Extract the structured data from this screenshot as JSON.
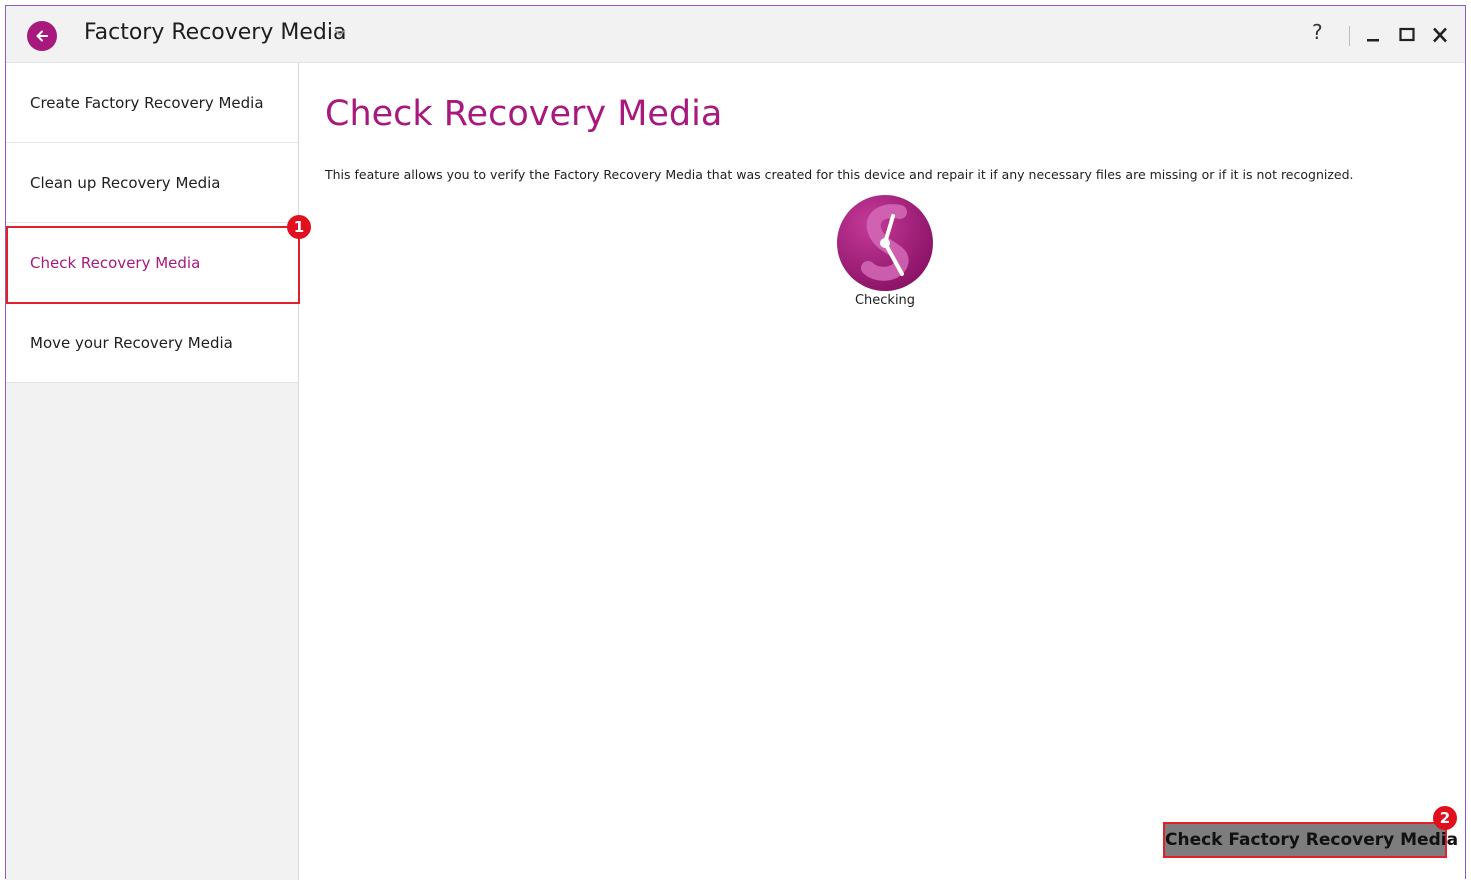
{
  "app": {
    "title": "Factory Recovery Media",
    "help_label": "?"
  },
  "sidebar": {
    "items": [
      {
        "label": "Create Factory Recovery Media"
      },
      {
        "label": "Clean up Recovery Media"
      },
      {
        "label": "Check Recovery Media",
        "active": true
      },
      {
        "label": "Move your Recovery Media"
      }
    ]
  },
  "main": {
    "title": "Check Recovery Media",
    "description": "This feature allows you to verify the Factory Recovery Media that was created for this device and repair it if any necessary files are missing or if it is not recognized.",
    "status": {
      "icon": "clock-icon",
      "label": "Checking"
    },
    "action_button": "Check Factory Recovery Media"
  },
  "annotations": [
    {
      "number": "1"
    },
    {
      "number": "2"
    }
  ],
  "colors": {
    "accent": "#a8197d",
    "annotation": "#e0202a",
    "button_bg": "#7d7d7d"
  }
}
